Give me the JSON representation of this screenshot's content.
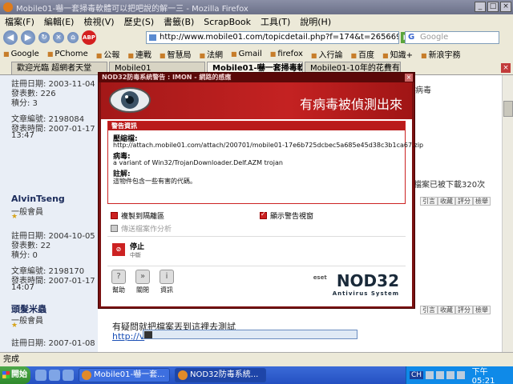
{
  "window": {
    "title": "Mobile01-嚇一套掃毒軟體可以把吧說的解一三 - Mozilla Firefox"
  },
  "menu": [
    "檔案(F)",
    "編輯(E)",
    "檢視(V)",
    "歷史(S)",
    "書籤(B)",
    "ScrapBook",
    "工具(T)",
    "說明(H)"
  ],
  "nav": {
    "url": "http://www.mobile01.com/topicdetail.php?f=174&t=265669",
    "search_placeholder": "Google"
  },
  "bookmarks": [
    "Google",
    "PChome",
    "公報",
    "連戰",
    "智慧局",
    "法網",
    "Gmail",
    "firefox",
    "入行論",
    "百度",
    "知識+",
    "新浪宇務"
  ],
  "tabs": [
    "歡迎光臨 超網者天堂",
    "Mobile01",
    "Mobile01-嚇一套掃毒軟...",
    "Mobile01-10年的花費有嚇..."
  ],
  "page": {
    "user1": {
      "reg": "註冊日期: 2003-11-04",
      "posts": "發表數: 226",
      "score": "積分: 3",
      "articles": "文章編號: 2198084",
      "time": "發表時間: 2007-01-17",
      "clock": "13:47"
    },
    "user2": {
      "name": "AlvinTseng",
      "rank": "一般會員",
      "reg": "註冊日期: 2004-10-05",
      "posts": "發表數: 22",
      "score": "積分: 0",
      "articles": "文章編號: 2198170",
      "time": "發表時間: 2007-01-17",
      "clock": "14:07"
    },
    "user3": {
      "name": "頭髮米蟲",
      "rank": "一般會員",
      "reg": "註冊日期: 2007-01-08"
    },
    "right_text1": "病毒",
    "right_text2": "檔案已被下載320次",
    "post_buttons": [
      "引言",
      "收藏",
      "評分",
      "檢舉"
    ],
    "bottom_text": "有疑問就把檔案丟到這裡去測試",
    "bottom_link": "http://v"
  },
  "dialog": {
    "title": "NOD32防毒系統警告 : IMON - 網路的感應",
    "headline": "有病毒被偵測出來",
    "warn_header": "警告資訊",
    "label_url": "壓縮檔:",
    "url": "http://attach.mobile01.com/attach/200701/mobile01-17e6b725dcbec5a685e45d38c3b1ca67.zip",
    "label_virus": "病毒:",
    "virus": "a variant of Win32/TrojanDownloader.Delf.AZM trojan",
    "label_note": "註解:",
    "note": "這物件包含一些有害的代碼。",
    "opt_quarantine": "複製到隔離區",
    "opt_show_window": "顯示警告視窗",
    "opt_send": "傳送檔案作分析",
    "stop_label": "停止",
    "stop_sub": "中斷",
    "btn_help": "幫助",
    "btn_close": "關閉",
    "btn_info": "資訊",
    "logo_eset": "eset",
    "logo_nod": "NOD32",
    "logo_sub": "Antivirus System"
  },
  "status": "完成",
  "taskbar": {
    "start": "開始",
    "tasks": [
      "Mobile01-嚇一套...",
      "NOD32防毒系統..."
    ],
    "lang": "CH",
    "clock": "下午 05:21"
  },
  "colors": {
    "dialog_red": "#c42222",
    "dialog_frame": "#7a1010",
    "taskbar_blue": "#2450c2",
    "start_green": "#3c9a3a"
  }
}
